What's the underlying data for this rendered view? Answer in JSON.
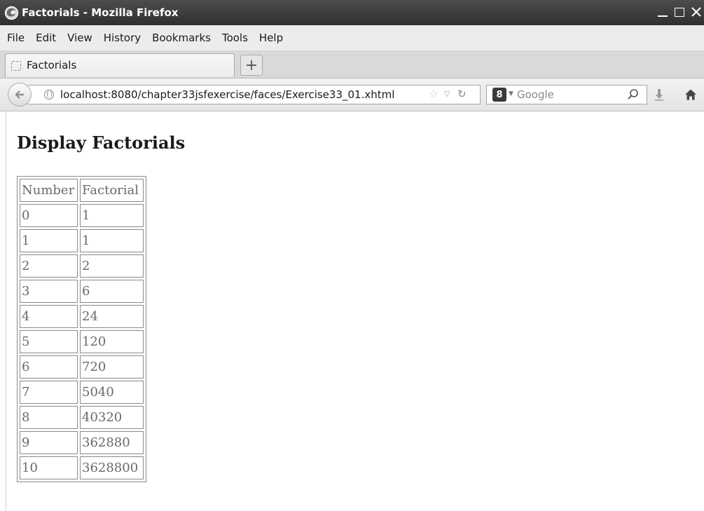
{
  "window": {
    "title": "Factorials - Mozilla Firefox"
  },
  "menu": {
    "items": [
      {
        "label": "File"
      },
      {
        "label": "Edit"
      },
      {
        "label": "View"
      },
      {
        "label": "History"
      },
      {
        "label": "Bookmarks"
      },
      {
        "label": "Tools"
      },
      {
        "label": "Help"
      }
    ]
  },
  "tabs": [
    {
      "title": "Factorials"
    }
  ],
  "newtab": {
    "label": "+"
  },
  "navbar": {
    "url": "localhost:8080/chapter33jsfexercise/faces/Exercise33_01.xhtml",
    "search_placeholder": "Google",
    "search_engine_glyph": "8"
  },
  "page": {
    "heading": "Display Factorials",
    "table": {
      "headers": [
        "Number",
        "Factorial"
      ],
      "rows": [
        [
          "0",
          "1"
        ],
        [
          "1",
          "1"
        ],
        [
          "2",
          "2"
        ],
        [
          "3",
          "6"
        ],
        [
          "4",
          "24"
        ],
        [
          "5",
          "120"
        ],
        [
          "6",
          "720"
        ],
        [
          "7",
          "5040"
        ],
        [
          "8",
          "40320"
        ],
        [
          "9",
          "362880"
        ],
        [
          "10",
          "3628800"
        ]
      ]
    }
  },
  "colors": {
    "titlebar": "#3d3d3d",
    "table_text": "#6a6a6a",
    "table_border": "#8a8a8a"
  }
}
